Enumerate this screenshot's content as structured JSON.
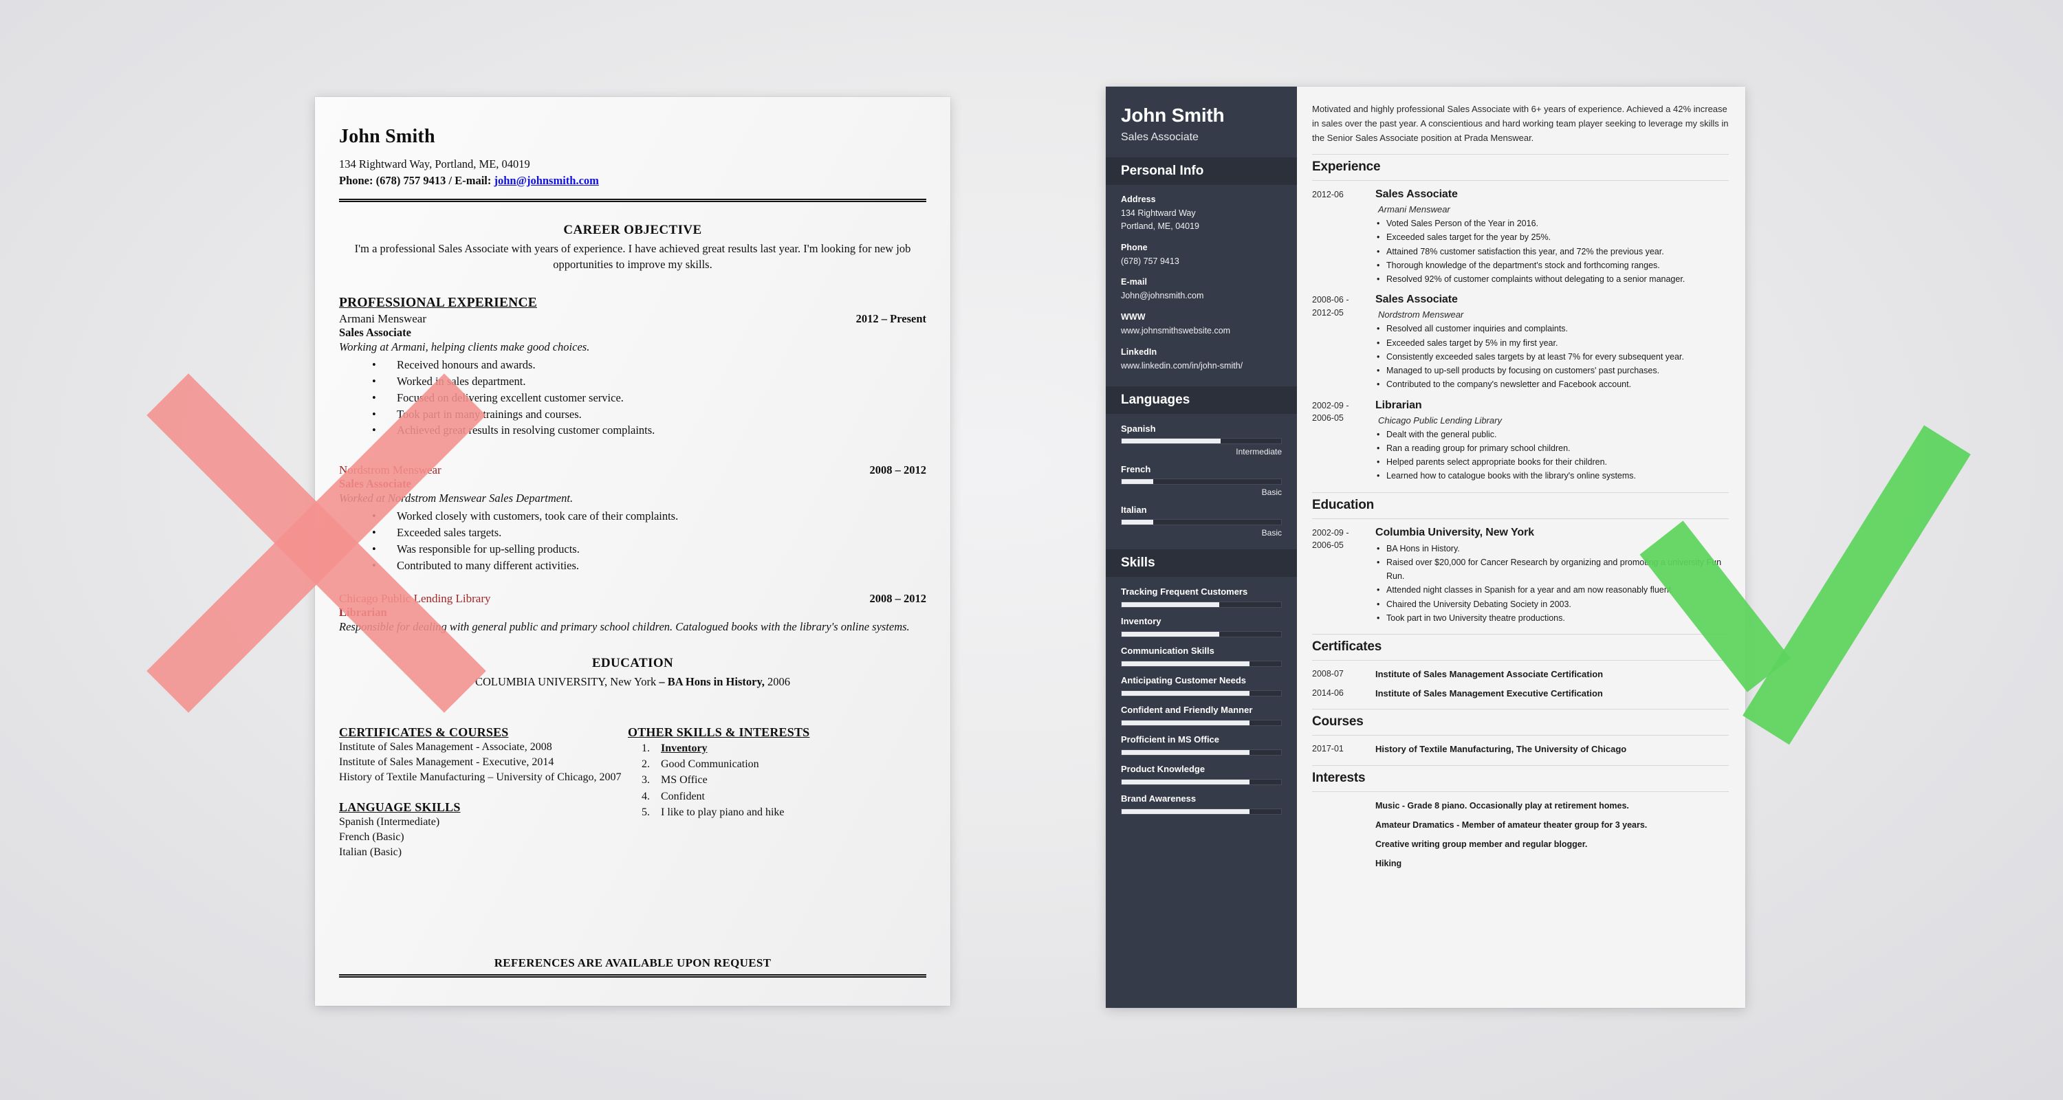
{
  "bad_resume": {
    "name": "John Smith",
    "address": "134 Rightward Way, Portland, ME, 04019",
    "phone_label": "Phone:",
    "phone": "(678) 757 9413",
    "email_sep": "/ E-mail:",
    "email": "john@johnsmith.com",
    "objective_heading": "CAREER OBJECTIVE",
    "objective_text": "I'm a professional Sales Associate with years of experience. I have achieved great results last year. I'm looking for new job opportunities to improve my skills.",
    "experience_heading": "PROFESSIONAL EXPERIENCE",
    "jobs": [
      {
        "employer": "Armani Menswear",
        "dates": "2012 – Present",
        "title": "Sales Associate",
        "desc": "Working at Armani, helping clients make good choices.",
        "bullets": [
          "Received honours and awards.",
          "Worked in sales department.",
          "Focused on delivering excellent customer service.",
          "Took part in many trainings and courses.",
          "Achieved great results in resolving customer complaints."
        ]
      },
      {
        "employer": "Nordstrom Menswear",
        "dates": "2008 – 2012",
        "title": "Sales Associate",
        "desc": "Worked at Nordstrom Menswear Sales Department.",
        "bullets": [
          "Worked closely with customers, took care of their complaints.",
          "Exceeded sales targets.",
          "Was responsible for up-selling products.",
          "Contributed to many different activities."
        ]
      },
      {
        "employer": "Chicago Public Lending Library",
        "dates": "2008 – 2012",
        "title": "Librarian",
        "desc": "Responsible for dealing with general public and primary school children. Catalogued books with the library's online systems.",
        "bullets": []
      }
    ],
    "education_heading": "EDUCATION",
    "education_text_plain_1": "COLUMBIA UNIVERSITY, New York",
    "education_text_bold": " – BA Hons in History,",
    "education_text_plain_2": " 2006",
    "certificates_heading": "CERTIFICATES & COURSES",
    "certificates": [
      "Institute of Sales Management - Associate, 2008",
      "Institute of Sales Management  - Executive, 2014",
      "History of Textile Manufacturing – University of Chicago, 2007"
    ],
    "languages_heading": "LANGUAGE SKILLS",
    "languages": [
      "Spanish (Intermediate)",
      "French (Basic)",
      "Italian (Basic)"
    ],
    "other_skills_heading": "OTHER SKILLS & INTERESTS",
    "other_skills": [
      "Inventory",
      "Good Communication",
      "MS Office",
      "Confident",
      "I like to play piano and hike"
    ],
    "references": "REFERENCES ARE AVAILABLE UPON REQUEST"
  },
  "good_resume": {
    "sidebar": {
      "name": "John Smith",
      "role": "Sales Associate",
      "personal_info_heading": "Personal Info",
      "fields": [
        {
          "label": "Address",
          "value": "134 Rightward Way\nPortland, ME, 04019"
        },
        {
          "label": "Phone",
          "value": "(678) 757 9413"
        },
        {
          "label": "E-mail",
          "value": "John@johnsmith.com"
        },
        {
          "label": "WWW",
          "value": "www.johnsmithswebsite.com"
        },
        {
          "label": "LinkedIn",
          "value": "www.linkedin.com/in/john-smith/"
        }
      ],
      "languages_heading": "Languages",
      "languages": [
        {
          "name": "Spanish",
          "level": "Intermediate",
          "percent": 62
        },
        {
          "name": "French",
          "level": "Basic",
          "percent": 20
        },
        {
          "name": "Italian",
          "level": "Basic",
          "percent": 20
        }
      ],
      "skills_heading": "Skills",
      "skills": [
        {
          "name": "Tracking Frequent Customers",
          "percent": 61
        },
        {
          "name": "Inventory",
          "percent": 61
        },
        {
          "name": "Communication Skills",
          "percent": 80
        },
        {
          "name": "Anticipating Customer Needs",
          "percent": 80
        },
        {
          "name": "Confident and Friendly Manner",
          "percent": 80
        },
        {
          "name": "Profficient in MS Office",
          "percent": 80
        },
        {
          "name": "Product Knowledge",
          "percent": 80
        },
        {
          "name": "Brand Awareness",
          "percent": 80
        }
      ]
    },
    "main": {
      "summary": "Motivated and highly professional Sales Associate with 6+ years of experience.  Achieved a 42% increase in sales over the past year. A conscientious and hard working team player seeking to leverage my skills in the Senior Sales Associate position at Prada Menswear.",
      "experience_heading": "Experience",
      "experience": [
        {
          "date": "2012-06",
          "job": "Sales Associate",
          "org": "Armani Menswear",
          "bullets": [
            "Voted Sales Person of the Year in 2016.",
            "Exceeded sales target for the year by 25%.",
            "Attained 78% customer satisfaction this year, and 72% the previous year.",
            "Thorough knowledge of the department's stock and forthcoming ranges.",
            "Resolved 92% of customer complaints without delegating to a senior manager."
          ]
        },
        {
          "date": "2008-06 -\n2012-05",
          "job": "Sales Associate",
          "org": "Nordstrom Menswear",
          "bullets": [
            "Resolved all customer inquiries and complaints.",
            "Exceeded sales target by 5% in my first year.",
            "Consistently exceeded sales targets by at least 7% for every subsequent year.",
            "Managed to up-sell products by focusing on customers' past purchases.",
            "Contributed to the company's newsletter and Facebook account."
          ]
        },
        {
          "date": "2002-09 -\n2006-05",
          "job": "Librarian",
          "org": "Chicago Public Lending Library",
          "bullets": [
            "Dealt with the general public.",
            "Ran a reading group for primary school children.",
            "Helped parents select appropriate books for their children.",
            "Learned how to catalogue books with the library's online systems."
          ]
        }
      ],
      "education_heading": "Education",
      "education": [
        {
          "date": "2002-09 -\n2006-05",
          "school": "Columbia University, New York",
          "bullets": [
            "BA Hons in History.",
            "Raised over $20,000 for Cancer Research by organizing and promoting a university Fun Run.",
            "Attended night classes in Spanish for a year and am now reasonably fluent.",
            "Chaired the University Debating Society in 2003.",
            "Took part in two University theatre productions."
          ]
        }
      ],
      "certificates_heading": "Certificates",
      "certificates": [
        {
          "date": "2008-07",
          "text": "Institute of Sales Management Associate Certification"
        },
        {
          "date": "2014-06",
          "text": "Institute of Sales Management Executive Certification"
        }
      ],
      "courses_heading": "Courses",
      "courses": [
        {
          "date": "2017-01",
          "text": "History of Textile Manufacturing, The University of Chicago"
        }
      ],
      "interests_heading": "Interests",
      "interests": [
        "Music - Grade 8 piano. Occasionally play at retirement homes.",
        "Amateur Dramatics - Member of amateur theater group for 3 years.",
        "Creative writing group member and regular blogger.",
        "Hiking"
      ]
    }
  },
  "annotations": {
    "reject_mark": "x-cross-mark",
    "accept_mark": "check-mark",
    "reject_color": "#f3918e",
    "accept_color": "#5cd45c"
  }
}
